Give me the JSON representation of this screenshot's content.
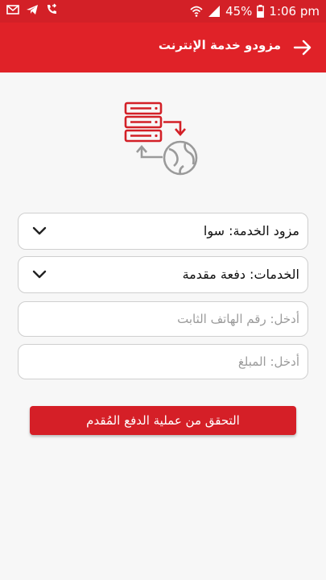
{
  "status_bar": {
    "battery_percent": "45%",
    "time": "1:06 pm",
    "icons": [
      "envelope-icon",
      "telegram-icon",
      "call-forward-icon",
      "wifi-icon",
      "signal-icon",
      "battery-icon"
    ]
  },
  "app_bar": {
    "title": "مزودو خدمة الإنترنت",
    "back_icon": "arrow-right-icon"
  },
  "hero": {
    "icon": "server-globe-icon"
  },
  "form": {
    "provider": {
      "label": "مزود الخدمة: سوا"
    },
    "service": {
      "label": "الخدمات: دفعة مقدمة"
    },
    "landline": {
      "placeholder": "أدخل: رقم الهاتف الثابت"
    },
    "amount": {
      "placeholder": "أدخل: المبلغ"
    },
    "submit_label": "التحقق من عملية الدفع المُقدم"
  },
  "colors": {
    "primary": "#e02228",
    "status_bar": "#d32027",
    "background": "#f7f7f7",
    "icon_red": "#d32027",
    "icon_gray": "#9a9a9a"
  }
}
